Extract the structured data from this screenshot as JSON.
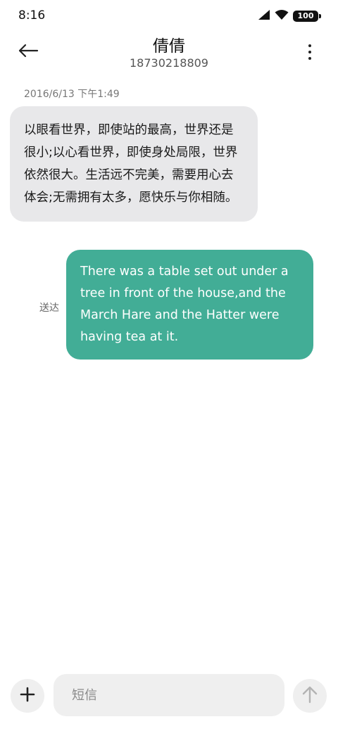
{
  "status_bar": {
    "time": "8:16",
    "battery": "100",
    "icons": [
      "signal-icon",
      "wifi-icon",
      "battery-icon"
    ]
  },
  "header": {
    "contact_name": "倩倩",
    "contact_number": "18730218809",
    "back_icon": "back-arrow-icon",
    "more_icon": "more-vertical-icon"
  },
  "conversation": {
    "timestamp": "2016/6/13 下午1:49",
    "received_message": "以眼看世界，即使站的最高，世界还是很小;以心看世界，即使身处局限，世界依然很大。生活远不完美，需要用心去体会;无需拥有太多，愿快乐与你相随。",
    "sent_message": "There was a table set out under a tree in front of the house,and the March Hare and the Hatter were having tea at it.",
    "sent_status": "送达"
  },
  "composer": {
    "placeholder": "短信",
    "value": "",
    "add_icon": "plus-icon",
    "send_icon": "arrow-up-icon"
  },
  "colors": {
    "received_bubble": "#e8e8ea",
    "sent_bubble": "#42ad96",
    "composer_bg": "#efefef"
  }
}
